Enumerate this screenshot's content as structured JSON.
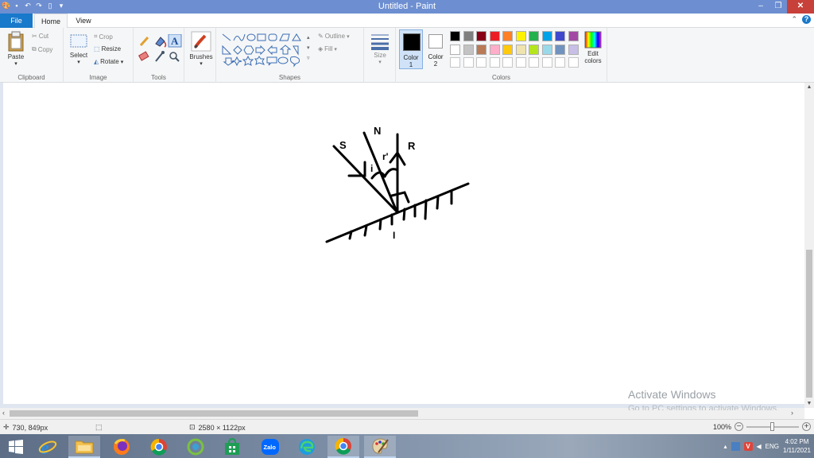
{
  "window": {
    "title": "Untitled - Paint",
    "minimize": "–",
    "restore": "❐",
    "close": "✕"
  },
  "tabs": {
    "file": "File",
    "home": "Home",
    "view": "View"
  },
  "ribbon": {
    "clipboard": {
      "label": "Clipboard",
      "paste": "Paste",
      "cut": "Cut",
      "copy": "Copy"
    },
    "image": {
      "label": "Image",
      "select": "Select",
      "crop": "Crop",
      "resize": "Resize",
      "rotate": "Rotate"
    },
    "tools": {
      "label": "Tools"
    },
    "brushes": {
      "label": "Brushes"
    },
    "shapes": {
      "label": "Shapes",
      "outline": "Outline",
      "fill": "Fill"
    },
    "size": {
      "label": "Size"
    },
    "colors": {
      "label": "Colors",
      "color1": "Color\n1",
      "color2": "Color\n2",
      "edit": "Edit\ncolors",
      "color1_value": "#000000",
      "color2_value": "#ffffff",
      "palette_row1": [
        "#000000",
        "#7f7f7f",
        "#880015",
        "#ed1c24",
        "#ff7f27",
        "#fff200",
        "#22b14c",
        "#00a2e8",
        "#3f48cc",
        "#a349a4"
      ],
      "palette_row2": [
        "#ffffff",
        "#c3c3c3",
        "#b97a57",
        "#ffaec9",
        "#ffc90e",
        "#efe4b0",
        "#b5e61d",
        "#99d9ea",
        "#7092be",
        "#c8bfe7"
      ]
    }
  },
  "drawing": {
    "label_s": "S",
    "label_n": "N",
    "label_r": "R",
    "label_i": "i",
    "label_r_prime": "r'",
    "label_i_below": "I"
  },
  "watermark": {
    "line1": "Activate Windows",
    "line2": "Go to PC settings to activate Windows."
  },
  "status": {
    "cursor_pos": "730, 849px",
    "image_size": "2580 × 1122px",
    "zoom": "100%",
    "zoom_fraction": 0.5
  },
  "taskbar": {
    "language": "ENG",
    "time": "4:02 PM",
    "date": "1/11/2021",
    "zalo": "Zalo"
  }
}
